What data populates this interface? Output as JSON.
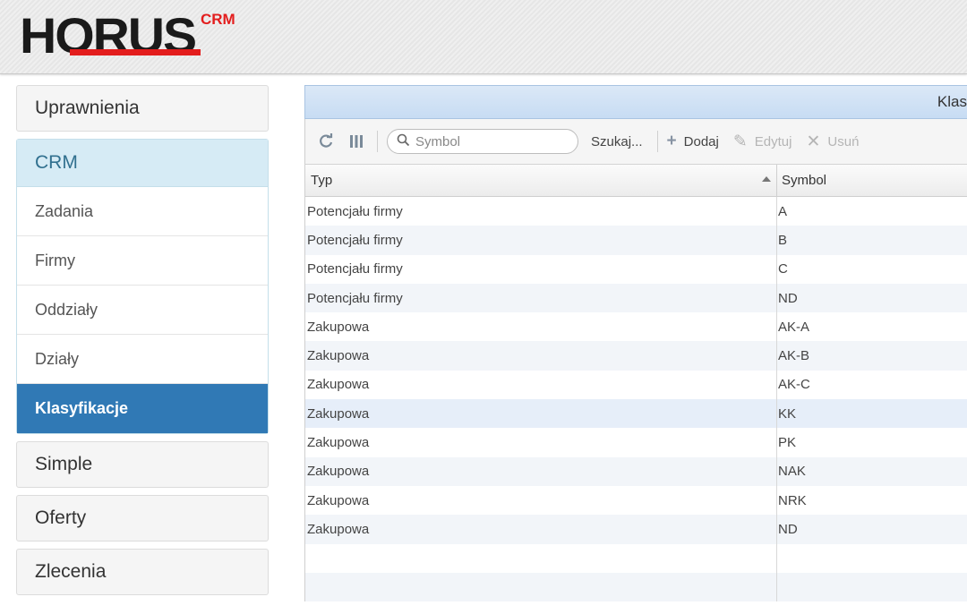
{
  "header": {
    "logo_text": "HORUS",
    "logo_sup": "CRM"
  },
  "sidebar": {
    "sections": [
      {
        "label": "Uprawnienia"
      },
      {
        "label": "CRM",
        "items": [
          {
            "label": "Zadania"
          },
          {
            "label": "Firmy"
          },
          {
            "label": "Oddziały"
          },
          {
            "label": "Działy"
          },
          {
            "label": "Klasyfikacje",
            "active": true
          }
        ]
      },
      {
        "label": "Simple"
      },
      {
        "label": "Oferty"
      },
      {
        "label": "Zlecenia"
      }
    ]
  },
  "grid": {
    "title": "Klas",
    "toolbar": {
      "search_placeholder": "Symbol",
      "search_button": "Szukaj...",
      "add_label": "Dodaj",
      "edit_label": "Edytuj",
      "delete_label": "Usuń"
    },
    "columns": [
      "Typ",
      "Symbol"
    ],
    "rows": [
      {
        "typ": "Potencjału firmy",
        "symbol": "A"
      },
      {
        "typ": "Potencjału firmy",
        "symbol": "B"
      },
      {
        "typ": "Potencjału firmy",
        "symbol": "C"
      },
      {
        "typ": "Potencjału firmy",
        "symbol": "ND"
      },
      {
        "typ": "Zakupowa",
        "symbol": "AK-A"
      },
      {
        "typ": "Zakupowa",
        "symbol": "AK-B"
      },
      {
        "typ": "Zakupowa",
        "symbol": "AK-C"
      },
      {
        "typ": "Zakupowa",
        "symbol": "KK",
        "selected": true
      },
      {
        "typ": "Zakupowa",
        "symbol": "PK"
      },
      {
        "typ": "Zakupowa",
        "symbol": "NAK"
      },
      {
        "typ": "Zakupowa",
        "symbol": "NRK"
      },
      {
        "typ": "Zakupowa",
        "symbol": "ND"
      }
    ]
  }
}
